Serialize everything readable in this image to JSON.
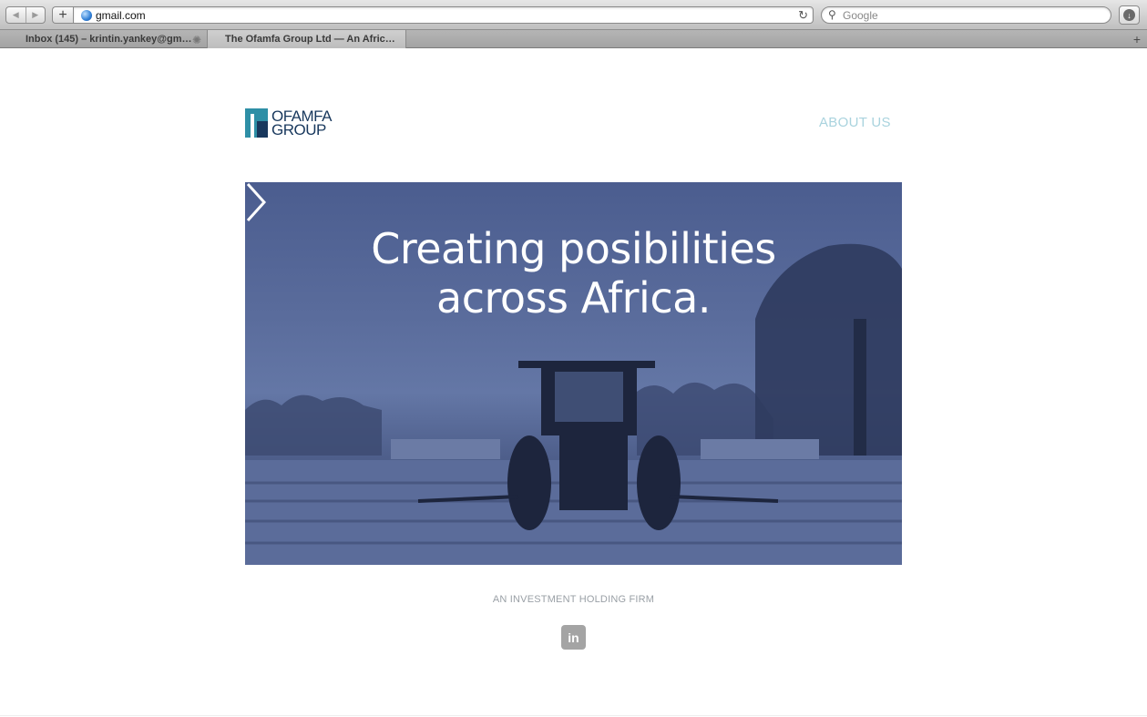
{
  "browser": {
    "url": "gmail.com",
    "search_placeholder": "Google",
    "tabs": [
      {
        "label": "Inbox (145) – krintin.yankey@gm…"
      },
      {
        "label": "The Ofamfa Group Ltd — An Afric…"
      }
    ]
  },
  "site": {
    "logo_line1": "OFAMFA",
    "logo_line2": "GROUP",
    "nav": {
      "about_label": "ABOUT US"
    },
    "hero": {
      "headline_line1": "Creating posibilities",
      "headline_line2": "across Africa."
    },
    "tagline": "AN INVESTMENT HOLDING FIRM",
    "linkedin_label": "in"
  },
  "colors": {
    "logo_teal": "#2e8fa6",
    "logo_navy": "#18385d",
    "nav_link": "#a9d3de",
    "hero_tint": "#5a6c9c"
  }
}
